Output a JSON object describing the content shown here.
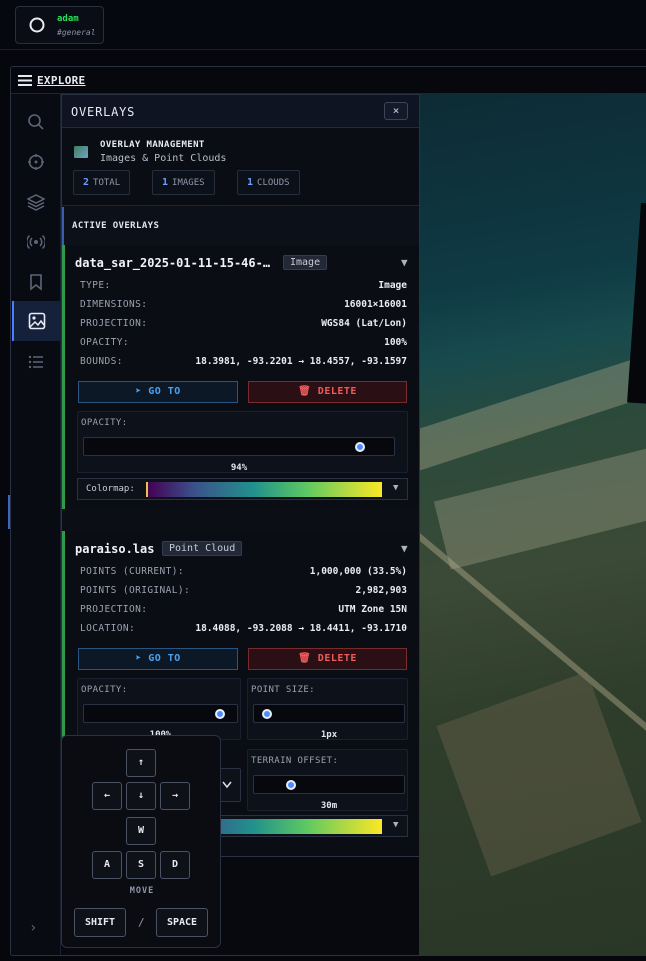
{
  "app": {
    "user": "adam",
    "channel": "#general"
  },
  "explore": {
    "label": "EXPLORE"
  },
  "sidebar": {
    "icons": [
      "search-icon",
      "crosshair-icon",
      "layers-icon",
      "broadcast-icon",
      "bookmark-icon",
      "image-icon",
      "list-icon"
    ],
    "active": "image-icon",
    "expand": "›"
  },
  "panel": {
    "title": "OVERLAYS",
    "close": "×",
    "management": {
      "title": "OVERLAY MANAGEMENT",
      "subtitle": "Images & Point Clouds",
      "stats": [
        {
          "count": "2",
          "label": "TOTAL"
        },
        {
          "count": "1",
          "label": "IMAGES"
        },
        {
          "count": "1",
          "label": "CLOUDS"
        }
      ]
    },
    "active_heading": "ACTIVE OVERLAYS",
    "overlays": [
      {
        "name": "data_sar_2025-01-11-15-46-…",
        "kind": "Image",
        "rows": [
          {
            "label": "TYPE:",
            "value": "Image"
          },
          {
            "label": "DIMENSIONS:",
            "value": "16001×16001"
          },
          {
            "label": "PROJECTION:",
            "value": "WGS84 (Lat/Lon)"
          },
          {
            "label": "OPACITY:",
            "value": "100%"
          },
          {
            "label": "BOUNDS:",
            "value": "18.3981, -93.2201 → 18.4557, -93.1597"
          }
        ],
        "goto": "GO TO",
        "delete": "DELETE",
        "opacity_label": "OPACITY:",
        "opacity_value": "94%",
        "opacity_fraction": 0.94,
        "colormap_label": "Colormap:"
      },
      {
        "name": "paraiso.las",
        "kind": "Point Cloud",
        "rows": [
          {
            "label": "POINTS (CURRENT):",
            "value": "1,000,000 (33.5%)"
          },
          {
            "label": "POINTS (ORIGINAL):",
            "value": "2,982,903"
          },
          {
            "label": "PROJECTION:",
            "value": "UTM Zone 15N"
          },
          {
            "label": "LOCATION:",
            "value": "18.4088, -93.2088 → 18.4411, -93.1710"
          }
        ],
        "goto": "GO TO",
        "delete": "DELETE",
        "opacity_label": "OPACITY:",
        "opacity_value": "100%",
        "opacity_fraction": 1.0,
        "point_size_label": "POINT SIZE:",
        "point_size_value": "1px",
        "point_size_fraction": 0.0,
        "terrain_label": "TERRAIN OFFSET:",
        "terrain_value": "30m",
        "terrain_fraction": 0.2
      }
    ]
  },
  "keyboard": {
    "arrows": {
      "up": "↑",
      "left": "←",
      "down": "↓",
      "right": "→"
    },
    "keys": {
      "w": "W",
      "a": "A",
      "s": "S",
      "d": "D"
    },
    "move_label": "MOVE",
    "shift": "SHIFT",
    "separator": "/",
    "space": "SPACE"
  }
}
